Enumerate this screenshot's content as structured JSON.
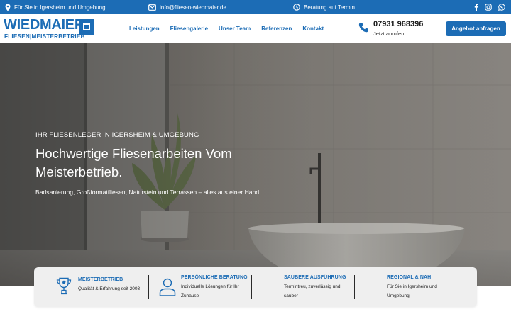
{
  "topbar": {
    "location": "Für Sie in Igersheim und Umgebung",
    "email": "info@fliesen-wiedmaier.de",
    "consult": "Beratung auf Termin",
    "socials": [
      "facebook-icon",
      "instagram-icon",
      "whatsapp-icon"
    ]
  },
  "header": {
    "logo_word": "WIEDMAIER",
    "logo_sub": "FLIESEN|MEISTERBETRIEB",
    "nav": [
      "Leistungen",
      "Fliesengalerie",
      "Unser Team",
      "Referenzen",
      "Kontakt"
    ],
    "phone_number": "07931 968396",
    "phone_sub": "Jetzt anrufen",
    "cta": "Angebot anfragen"
  },
  "hero": {
    "kicker": "IHR FLIESENLEGER IN IGERSHEIM & UMGEBUNG",
    "title_line1": "Hochwertige Fliesenarbeiten Vom",
    "title_line2": "Meisterbetrieb.",
    "description": "Badsanierung, Großformatfliesen, Naturstein und Terrassen – alles aus einer Hand."
  },
  "features": [
    {
      "icon": "trophy-icon",
      "title": "MEISTERBETRIEB",
      "desc": "Qualität & Erfahrung seit 2003"
    },
    {
      "icon": "person-icon",
      "title": "PERSÖNLICHE BERATUNG",
      "desc": "Individuelle Lösungen für Ihr Zuhause"
    },
    {
      "icon": "",
      "title": "SAUBERE AUSFÜHRUNG",
      "desc": "Termintreu, zuverlässig und sauber"
    },
    {
      "icon": "",
      "title": "REGIONAL & NAH",
      "desc": "Für Sie in Igersheim und Umgebung"
    }
  ],
  "colors": {
    "brand": "#1c6cb5",
    "topbar": "#1c6cb5",
    "feature_bg": "#efefef"
  }
}
